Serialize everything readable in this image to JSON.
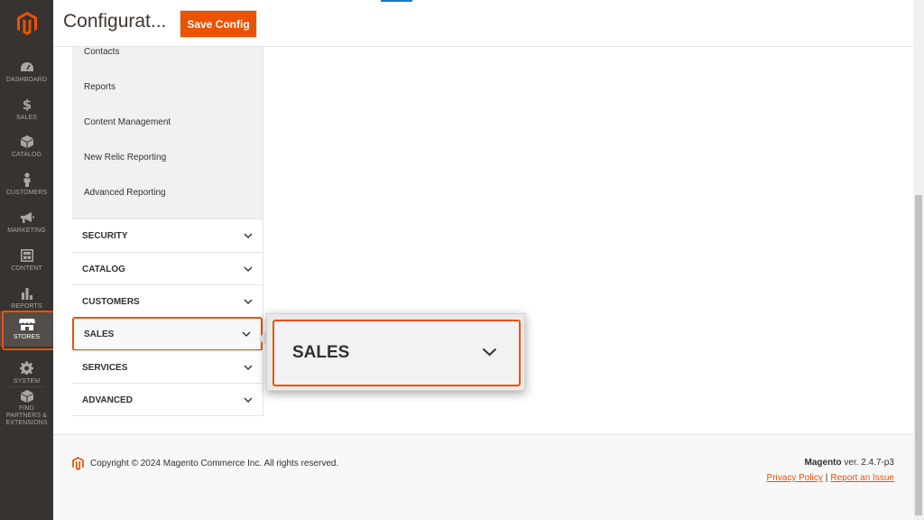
{
  "nav": {
    "items": [
      {
        "label": "DASHBOARD",
        "icon": "dashboard-icon"
      },
      {
        "label": "SALES",
        "icon": "dollar-icon"
      },
      {
        "label": "CATALOG",
        "icon": "box-icon"
      },
      {
        "label": "CUSTOMERS",
        "icon": "person-icon"
      },
      {
        "label": "MARKETING",
        "icon": "megaphone-icon"
      },
      {
        "label": "CONTENT",
        "icon": "content-icon"
      },
      {
        "label": "REPORTS",
        "icon": "bar-chart-icon"
      },
      {
        "label": "STORES",
        "icon": "store-icon"
      },
      {
        "label": "SYSTEM",
        "icon": "gear-icon"
      },
      {
        "label": "FIND PARTNERS & EXTENSIONS",
        "icon": "cube-icon"
      }
    ],
    "active": "STORES"
  },
  "header": {
    "title": "Configurat...",
    "save_label": "Save Config"
  },
  "config_nav": {
    "sub_items": [
      "Contacts",
      "Reports",
      "Content Management",
      "New Relic Reporting",
      "Advanced Reporting"
    ],
    "sections": [
      "SECURITY",
      "CATALOG",
      "CUSTOMERS",
      "SALES",
      "SERVICES",
      "ADVANCED"
    ],
    "highlighted": "SALES"
  },
  "callout": {
    "title": "SALES"
  },
  "footer": {
    "copyright": "Copyright © 2024 Magento Commerce Inc. All rights reserved.",
    "brand": "Magento",
    "version": " ver. 2.4.7-p3",
    "privacy_label": "Privacy Policy",
    "separator": "|",
    "report_label": "Report an Issue"
  },
  "colors": {
    "accent": "#eb5202",
    "nav_bg": "#373330"
  }
}
